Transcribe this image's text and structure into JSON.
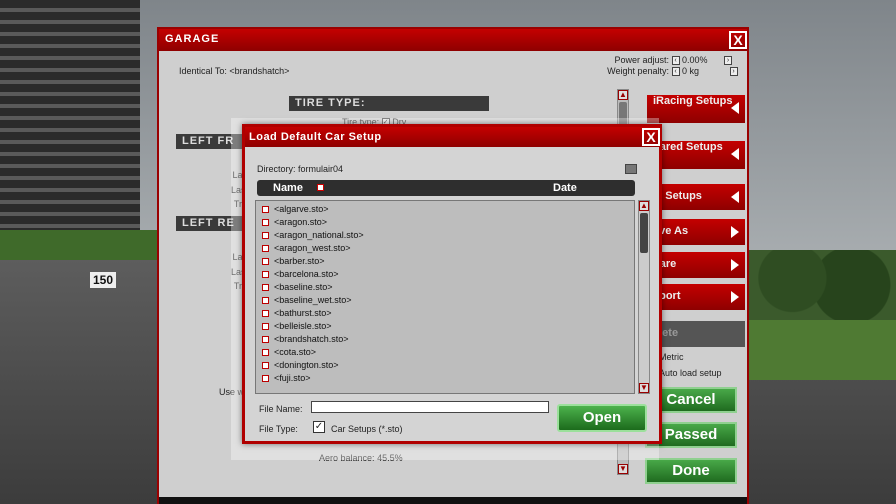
{
  "garage": {
    "title": "GARAGE",
    "close_glyph": "X",
    "identical_to": "Identical To: <brandshatch>",
    "power_adjust_label": "Power adjust:",
    "power_adjust_value": "0.00%",
    "weight_penalty_label": "Weight penalty:",
    "weight_penalty_value": "0 kg",
    "tire_type_header": "TIRE TYPE:",
    "tire_type_label": "Tire type:",
    "tire_type_value": "Dry",
    "left_front_header": "LEFT FR",
    "left_rear_header": "LEFT RE",
    "rows_front": [
      "Cold pr",
      "Last hot pr",
      "Last temps",
      "Tread rem"
    ],
    "rows_rear": [
      "Cold pr",
      "Last hot pr",
      "Last temps",
      "Tread rem"
    ],
    "use_label": "Use w",
    "aero_label": "Aero balance:",
    "aero_value": "45.5%",
    "menu": [
      {
        "label": "iRacing Setups",
        "chevron": "left"
      },
      {
        "label": "hared Setups",
        "chevron": "left"
      },
      {
        "label": "ly Setups",
        "chevron": "left"
      },
      {
        "label": "ave As",
        "chevron": "right"
      },
      {
        "label": "hare",
        "chevron": "right"
      },
      {
        "label": "xport",
        "chevron": "right"
      },
      {
        "label": "elete",
        "chevron": "none"
      }
    ],
    "metric_label": "Metric",
    "auto_load_label": "Auto load setup",
    "cancel_label": "Cancel",
    "passed_label": "Passed",
    "done_label": "Done"
  },
  "background": {
    "sign_number": "150"
  },
  "dialog": {
    "title": "Load Default Car Setup",
    "close_glyph": "X",
    "directory_label": "Directory:",
    "directory_value": "formulair04",
    "col_name": "Name",
    "col_date": "Date",
    "files": [
      "<algarve.sto>",
      "<aragon.sto>",
      "<aragon_national.sto>",
      "<aragon_west.sto>",
      "<barber.sto>",
      "<barcelona.sto>",
      "<baseline.sto>",
      "<baseline_wet.sto>",
      "<bathurst.sto>",
      "<belleisle.sto>",
      "<brandshatch.sto>",
      "<cota.sto>",
      "<donington.sto>",
      "<fuji.sto>"
    ],
    "file_name_label": "File Name:",
    "file_name_value": "",
    "file_type_label": "File Type:",
    "file_type_value": "Car Setups (*.sto)",
    "open_label": "Open"
  }
}
